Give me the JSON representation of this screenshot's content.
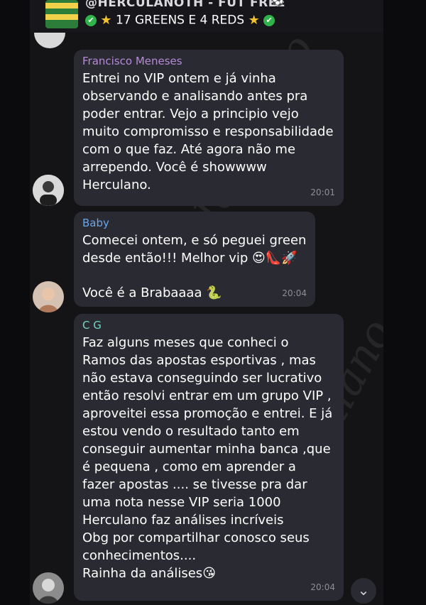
{
  "header": {
    "title": "@HERCULANOTH - FUT FREE",
    "subtitle": "17 GREENS E 4 REDS",
    "check_icon": "check-circle-icon",
    "star_icon": "star-icon",
    "ball_icon": "soccer-ball-icon",
    "accent_green": "#2fb34a",
    "star_color": "#f3c232"
  },
  "messages": [
    {
      "sender": "Francisco Meneses",
      "sender_color": "#b58ad6",
      "text": "Entrei no VIP ontem e já vinha\nobservando e analisando antes pra\npoder entrar. Vejo a principio vejo\nmuito compromisso e responsabilidade\ncom o que faz. Até agora não me\narrependo. Você é showwww\nHerculano.",
      "time": "20:01"
    },
    {
      "sender": "Baby",
      "sender_color": "#6aa6e8",
      "text": "Comecei ontem, e só peguei green\ndesde então!!! Melhor vip 😍👠🚀",
      "text2": "Você é a Brabaaaa 🐍",
      "time": "20:04"
    },
    {
      "sender": "C G",
      "sender_color": "#74d6c6",
      "text": "Faz alguns meses que conheci o\nRamos das apostas esportivas , mas\nnão  estava conseguindo ser lucrativo\nentão  resolvi entrar em um grupo VIP ,\naproveitei essa promoção  e entrei. E já\nestou vendo o  resultado tanto em\nconseguir aumentar minha banca ,que\né  pequena  , como em aprender a\nfazer apostas  .... se tivesse pra dar\numa nota nesse VIP seria 1000\nHerculano  faz análises incríveis\nObg por compartilhar conosco  seus\nconhecimentos....\nRainha da análises😘",
      "time": "20:04"
    }
  ],
  "scroll_down_icon": "chevron-down-icon"
}
